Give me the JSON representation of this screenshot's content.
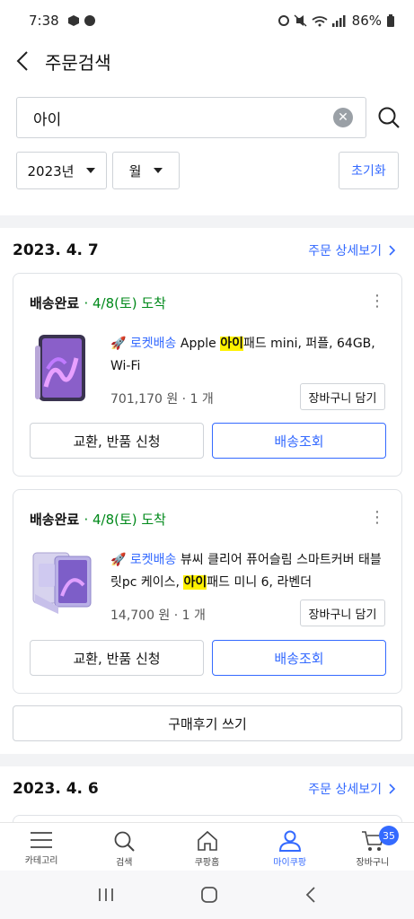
{
  "status_bar": {
    "time": "7:38",
    "battery": "86%"
  },
  "header": {
    "title": "주문검색"
  },
  "search": {
    "value": "아이"
  },
  "filters": {
    "year": "2023년",
    "month": "월",
    "reset": "초기화"
  },
  "orders": [
    {
      "date": "2023. 4. 7",
      "detail_link": "주문 상세보기",
      "items": [
        {
          "status": "배송완료",
          "arrival": "· 4/8(토) 도착",
          "rocket": "로켓배송",
          "name_before": " Apple ",
          "name_highlight": "아이",
          "name_after": "패드 mini, 퍼플, 64GB, Wi-Fi",
          "price": "701,170 원 · 1 개",
          "cart_button": "장바구니 담기",
          "exchange_button": "교환, 반품 신청",
          "track_button": "배송조회"
        },
        {
          "status": "배송완료",
          "arrival": "· 4/8(토) 도착",
          "rocket": "로켓배송",
          "name_before": " 뷰씨 클리어 퓨어슬림 스마트커버 태블릿pc 케이스, ",
          "name_highlight": "아이",
          "name_after": "패드 미니 6, 라벤더",
          "price": "14,700 원 · 1 개",
          "cart_button": "장바구니 담기",
          "exchange_button": "교환, 반품 신청",
          "track_button": "배송조회"
        }
      ],
      "review_button": "구매후기 쓰기"
    },
    {
      "date": "2023. 4. 6",
      "detail_link": "주문 상세보기"
    }
  ],
  "tabbar": {
    "items": [
      {
        "label": "카테고리",
        "icon": "menu-icon"
      },
      {
        "label": "검색",
        "icon": "search-icon"
      },
      {
        "label": "쿠팡홈",
        "icon": "home-icon"
      },
      {
        "label": "마이쿠팡",
        "icon": "person-icon"
      },
      {
        "label": "장바구니",
        "icon": "cart-icon"
      }
    ],
    "active_index": 3,
    "cart_count": "35"
  },
  "colors": {
    "accent": "#346aff",
    "arrival": "#00891a",
    "highlight": "#fff200"
  }
}
